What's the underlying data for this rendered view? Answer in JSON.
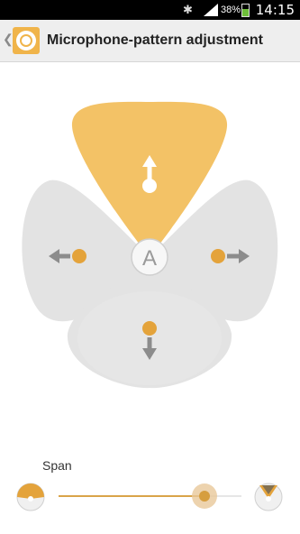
{
  "status_bar": {
    "time": "14:15",
    "battery_percent": "38%",
    "bluetooth_icon": "bluetooth-icon",
    "signal_icon": "signal-icon",
    "battery_icon": "battery-icon"
  },
  "action_bar": {
    "back_icon": "chevron-left-icon",
    "app_icon": "microphone-pattern-icon",
    "title": "Microphone-pattern adjustment"
  },
  "pattern": {
    "center_label": "A",
    "directions": [
      "up",
      "left",
      "right",
      "down"
    ],
    "active_direction": "up",
    "accent_color": "#f2bf5e",
    "lobe_color": "#e3e3e3"
  },
  "span": {
    "label": "Span",
    "value": 0.8,
    "min_icon": "wide-pattern-icon",
    "max_icon": "narrow-pattern-icon"
  }
}
